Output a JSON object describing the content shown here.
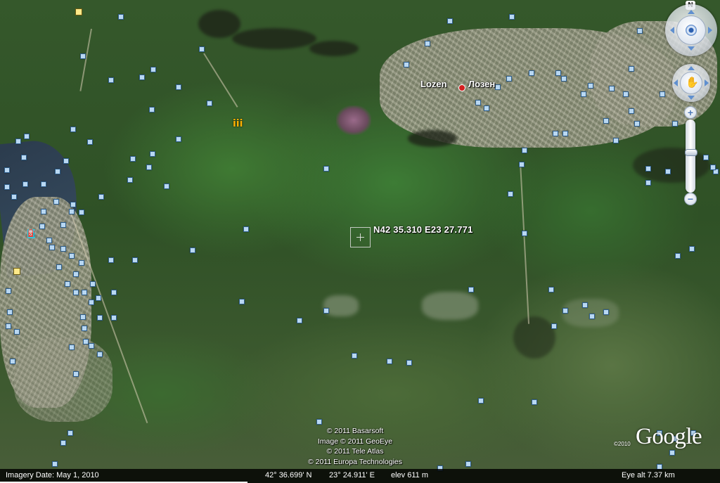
{
  "coordinates": {
    "label": "N42 35.310 E23 27.771"
  },
  "places": [
    {
      "latin": "Lozen",
      "cyrillic": "Лозен"
    }
  ],
  "navigation": {
    "north": "N",
    "zoom_in": "+",
    "zoom_out": "−",
    "zoom_level_fraction": 0.45
  },
  "attribution": {
    "lines": [
      "© 2011 Basarsoft",
      "Image © 2011 GeoEye",
      "© 2011 Tele Atlas",
      "© 2011 Europa Technologies"
    ],
    "logo": "Google",
    "logo_year": "©2010"
  },
  "status": {
    "imagery_date": "Imagery Date: May  1, 2010",
    "lat": "42° 36.699' N",
    "lon": "23° 24.911' E",
    "elev": "elev  611 m",
    "eye_alt": "Eye alt    7.37 km"
  },
  "colors": {
    "marker": "#d41f1f",
    "placemark_fill": "#b9d8f2",
    "nav_arrow": "#5f8fcf",
    "status_bar": "#000000"
  },
  "icons": {
    "gas_station": "gas-station-icon",
    "museum": "museum-icon",
    "place_marker": "city-marker-icon"
  }
}
